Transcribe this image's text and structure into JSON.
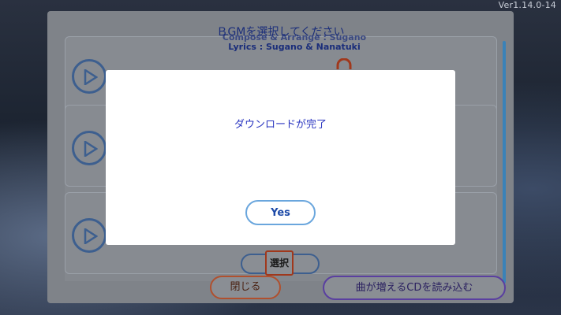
{
  "app": {
    "version": "Ver1.14.0-14"
  },
  "bgm_panel": {
    "title": "ＢGMを選択してください",
    "credits_line1": "Compose & Arrange : Sugano",
    "credits_line2": "Lyrics : Sugano & Nanatuki",
    "select_badge": "選択",
    "close_label": "閉じる",
    "load_cd_label": "曲が増えるCDを読み込む"
  },
  "dialog": {
    "message": "ダウンロードが完了",
    "yes_label": "Yes"
  },
  "icons": [
    "play-icon",
    "lock-icon"
  ],
  "colors": {
    "dialog_text": "#2a35c0",
    "yes_border": "#6aa6dd",
    "panel_overlay": "#7f8389"
  }
}
